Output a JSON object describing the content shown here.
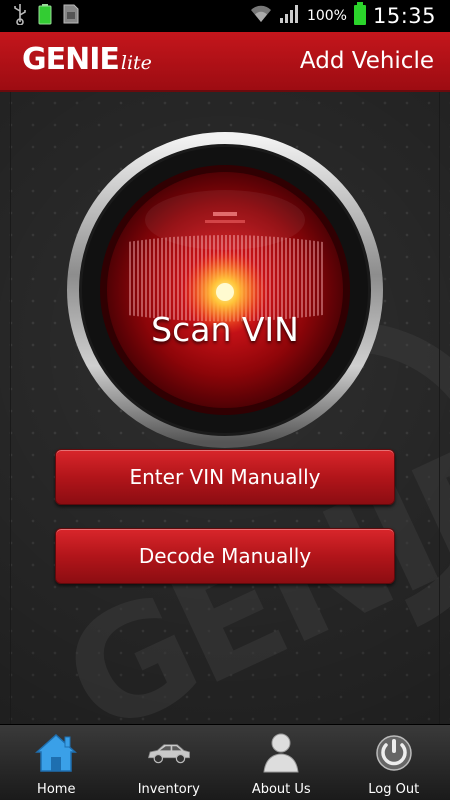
{
  "status_bar": {
    "battery_percent": "100%",
    "time": "15:35"
  },
  "header": {
    "logo_main": "GENIE",
    "logo_sub": "lite",
    "title": "Add Vehicle"
  },
  "scan": {
    "label": "Scan VIN"
  },
  "buttons": {
    "enter_vin": "Enter VIN Manually",
    "decode": "Decode Manually"
  },
  "watermark": "GENIE",
  "nav": [
    {
      "label": "Home",
      "icon": "home-icon",
      "active": true
    },
    {
      "label": "Inventory",
      "icon": "car-icon",
      "active": false
    },
    {
      "label": "About Us",
      "icon": "person-icon",
      "active": false
    },
    {
      "label": "Log Out",
      "icon": "power-icon",
      "active": false
    }
  ],
  "colors": {
    "brand_red": "#c4161c",
    "active_nav": "#3aa0e8"
  }
}
